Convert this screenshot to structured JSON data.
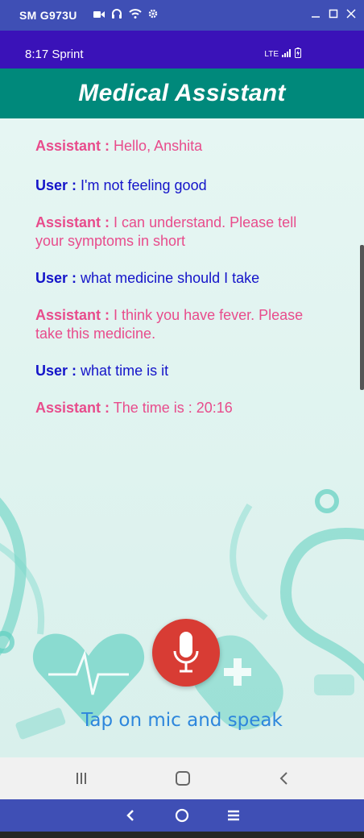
{
  "window": {
    "title": "SM G973U",
    "icons": [
      "video-icon",
      "headset-icon",
      "wifi-icon",
      "gear-icon"
    ],
    "controls": [
      "minimize-icon",
      "maximize-icon",
      "close-icon"
    ]
  },
  "status_bar": {
    "time_carrier": "8:17 Sprint",
    "network": "LTE",
    "icons": [
      "signal-icon",
      "battery-icon"
    ]
  },
  "app_bar": {
    "title": "Medical Assistant"
  },
  "chat": {
    "messages": [
      {
        "sender": "Assistant :",
        "text": "Hello, Anshita",
        "role": "assistant"
      },
      {
        "sender": "User :",
        "text": "I'm not feeling good",
        "role": "user"
      },
      {
        "sender": "Assistant :",
        "text": "I can understand. Please tell your symptoms in short",
        "role": "assistant"
      },
      {
        "sender": "User :",
        "text": "what medicine should I take",
        "role": "user"
      },
      {
        "sender": "Assistant :",
        "text": "I think you have fever. Please take this medicine.",
        "role": "assistant"
      },
      {
        "sender": "User :",
        "text": "what time is it",
        "role": "user"
      },
      {
        "sender": "Assistant :",
        "text": "The time is : 20:16",
        "role": "assistant"
      }
    ]
  },
  "mic": {
    "icon": "microphone-icon"
  },
  "hint": {
    "text": "Tap on mic and speak"
  },
  "android_nav": {
    "icons": [
      "recents-icon",
      "home-icon",
      "back-icon"
    ]
  },
  "emulator_nav": {
    "icons": [
      "back-icon",
      "home-icon",
      "menu-icon"
    ]
  },
  "colors": {
    "window_bar": "#3f4fb5",
    "status_bar": "#3a12b8",
    "app_bar": "#00897b",
    "user_text": "#1414c9",
    "assistant_text": "#e84c8c",
    "mic_button": "#d83c34",
    "hint_text": "#2d86dc"
  }
}
